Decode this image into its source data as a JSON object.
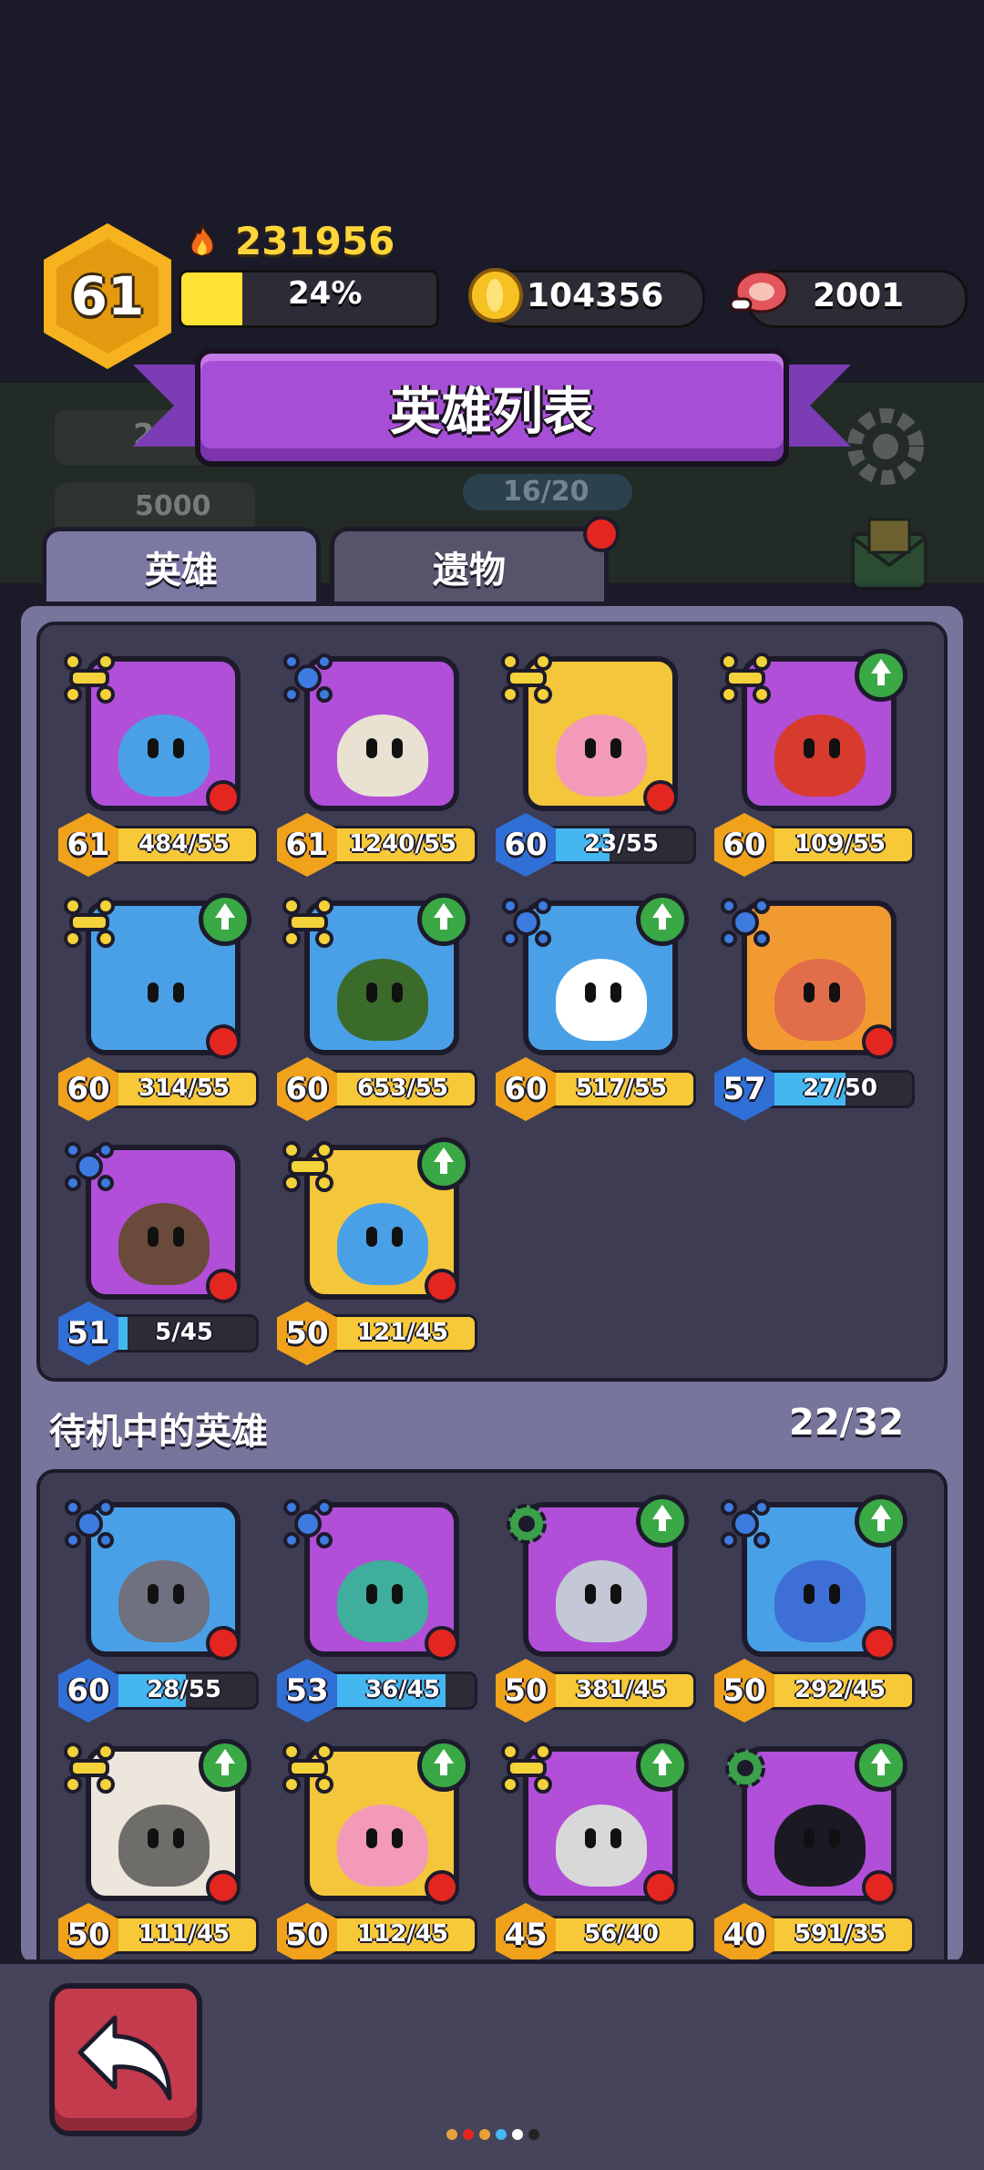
{
  "player": {
    "level": "61",
    "power": "231956",
    "xp_percent_label": "24%",
    "xp_fraction": 0.24
  },
  "resources": {
    "coins": "104356",
    "meat": "2001"
  },
  "title": "英雄列表",
  "tabs": [
    {
      "label": "英雄"
    },
    {
      "label": "遗物"
    }
  ],
  "background_ghost": {
    "capacity": "16/20",
    "val1": "2",
    "val2": "5000"
  },
  "active_heroes": [
    {
      "level": "61",
      "progress": "484/55",
      "fill": 1.0,
      "color": "gold",
      "bg": "#b14fd8",
      "class_icon": "crossed-bones-icon",
      "upgrade": false,
      "red_dot": true,
      "face": "#4aa0e6"
    },
    {
      "level": "61",
      "progress": "1240/55",
      "fill": 1.0,
      "color": "gold",
      "bg": "#b14fd8",
      "class_icon": "crossed-swords-blue-icon",
      "upgrade": false,
      "red_dot": false,
      "face": "#e9e2d2"
    },
    {
      "level": "60",
      "progress": "23/55",
      "fill": 0.42,
      "color": "blue",
      "bg": "#f3c63b",
      "class_icon": "crossed-bones-icon",
      "upgrade": false,
      "red_dot": true,
      "face": "#f29ab8"
    },
    {
      "level": "60",
      "progress": "109/55",
      "fill": 1.0,
      "color": "gold",
      "bg": "#b14fd8",
      "class_icon": "crossed-bones-icon",
      "upgrade": true,
      "red_dot": false,
      "face": "#d63b2e"
    },
    {
      "level": "60",
      "progress": "314/55",
      "fill": 1.0,
      "color": "gold",
      "bg": "#4aa0e6",
      "class_icon": "crossed-bones-icon",
      "upgrade": true,
      "red_dot": true,
      "face": "#4aa0e6"
    },
    {
      "level": "60",
      "progress": "653/55",
      "fill": 1.0,
      "color": "gold",
      "bg": "#4aa0e6",
      "class_icon": "crossed-bones-icon",
      "upgrade": true,
      "red_dot": false,
      "face": "#3a6b2a"
    },
    {
      "level": "60",
      "progress": "517/55",
      "fill": 1.0,
      "color": "gold",
      "bg": "#4aa0e6",
      "class_icon": "crossed-swords-blue-icon",
      "upgrade": true,
      "red_dot": false,
      "face": "#ffffff"
    },
    {
      "level": "57",
      "progress": "27/50",
      "fill": 0.54,
      "color": "blue",
      "bg": "#f29a32",
      "class_icon": "crossed-swords-blue-icon",
      "upgrade": false,
      "red_dot": true,
      "face": "#e26d4a"
    },
    {
      "level": "51",
      "progress": "5/45",
      "fill": 0.11,
      "color": "blue",
      "bg": "#b14fd8",
      "class_icon": "crossed-swords-blue-icon",
      "upgrade": false,
      "red_dot": true,
      "face": "#6a4a3a"
    },
    {
      "level": "50",
      "progress": "121/45",
      "fill": 1.0,
      "color": "gold",
      "bg": "#f3c63b",
      "class_icon": "crossed-bones-icon",
      "upgrade": true,
      "red_dot": true,
      "face": "#4aa0e6"
    }
  ],
  "standby": {
    "label": "待机中的英雄",
    "count": "22/32"
  },
  "standby_heroes": [
    {
      "level": "60",
      "progress": "28/55",
      "fill": 0.51,
      "color": "blue",
      "bg": "#4aa0e6",
      "class_icon": "crossed-swords-blue-icon",
      "upgrade": false,
      "red_dot": true,
      "face": "#6f7080"
    },
    {
      "level": "53",
      "progress": "36/45",
      "fill": 0.8,
      "color": "blue",
      "bg": "#b14fd8",
      "class_icon": "crossed-swords-blue-icon",
      "upgrade": false,
      "red_dot": true,
      "face": "#3fae9c"
    },
    {
      "level": "50",
      "progress": "381/45",
      "fill": 1.0,
      "color": "gold",
      "bg": "#b14fd8",
      "class_icon": "green-gear-icon",
      "upgrade": true,
      "red_dot": false,
      "face": "#c4c7d6"
    },
    {
      "level": "50",
      "progress": "292/45",
      "fill": 1.0,
      "color": "gold",
      "bg": "#4aa0e6",
      "class_icon": "crossed-swords-blue-icon",
      "upgrade": true,
      "red_dot": true,
      "face": "#3d6fd6"
    },
    {
      "level": "50",
      "progress": "111/45",
      "fill": 1.0,
      "color": "gold",
      "bg": "#ece6dc",
      "class_icon": "crossed-bones-icon",
      "upgrade": true,
      "red_dot": true,
      "face": "#6f6d6a"
    },
    {
      "level": "50",
      "progress": "112/45",
      "fill": 1.0,
      "color": "gold",
      "bg": "#f3c63b",
      "class_icon": "crossed-bones-icon",
      "upgrade": true,
      "red_dot": true,
      "face": "#f29ab8"
    },
    {
      "level": "45",
      "progress": "56/40",
      "fill": 1.0,
      "color": "gold",
      "bg": "#b14fd8",
      "class_icon": "crossed-bones-icon",
      "upgrade": true,
      "red_dot": true,
      "face": "#d8d8d8"
    },
    {
      "level": "40",
      "progress": "591/35",
      "fill": 1.0,
      "color": "gold",
      "bg": "#b14fd8",
      "class_icon": "green-gear-icon",
      "upgrade": true,
      "red_dot": true,
      "face": "#1b1a24"
    }
  ],
  "page_dots": [
    "#e8a13a",
    "#e3261f",
    "#e8a13a",
    "#45b7f0",
    "#ffffff",
    "#222222"
  ]
}
